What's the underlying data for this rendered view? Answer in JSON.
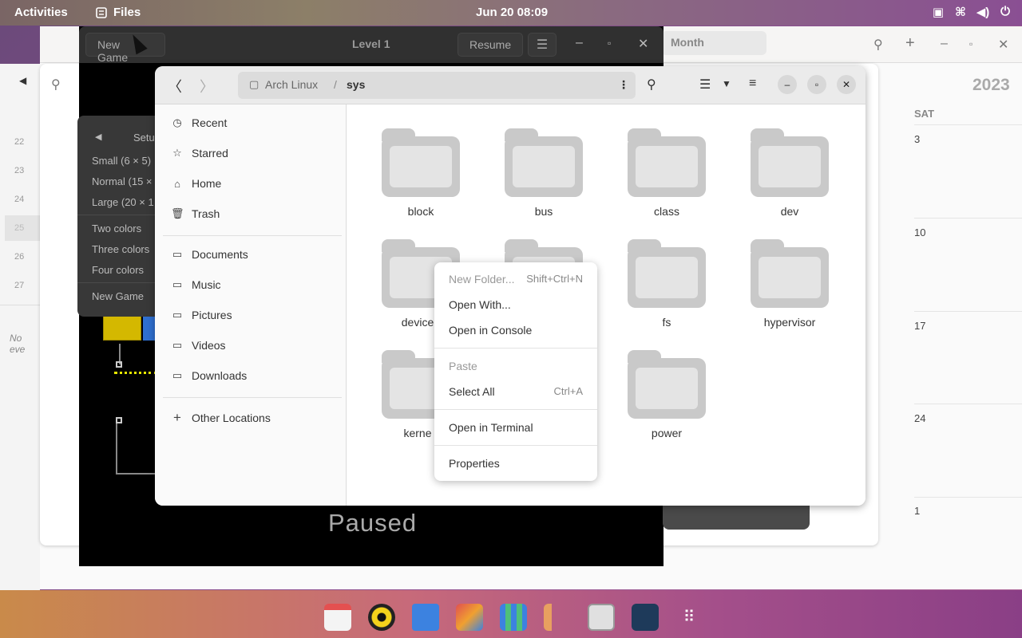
{
  "topbar": {
    "activities": "Activities",
    "app_name": "Files",
    "clock": "Jun 20  08:09"
  },
  "calendar": {
    "month_label": "Month",
    "year": "2023",
    "weekday": "SAT",
    "days": [
      "3",
      "10",
      "17",
      "24",
      "1"
    ],
    "weeks": [
      "22",
      "23",
      "24",
      "25",
      "26",
      "27"
    ],
    "no_events": "No eve"
  },
  "game": {
    "new_game": "New Game",
    "title": "Level 1",
    "resume": "Resume",
    "paused": "Paused",
    "setup_header": "Setu",
    "menu": {
      "small": "Small (6 × 5)",
      "normal": "Normal (15 ×",
      "large": "Large (20 × 1",
      "two": "Two colors",
      "three": "Three colors",
      "four": "Four colors",
      "new_game": "New Game"
    }
  },
  "files": {
    "path": [
      "Arch Linux",
      "/",
      "sys"
    ],
    "sidebar": {
      "recent": "Recent",
      "starred": "Starred",
      "home": "Home",
      "trash": "Trash",
      "documents": "Documents",
      "music": "Music",
      "pictures": "Pictures",
      "videos": "Videos",
      "downloads": "Downloads",
      "other": "Other Locations"
    },
    "folders": [
      "block",
      "bus",
      "class",
      "dev",
      "device",
      "fs",
      "hypervisor",
      "kerne",
      "power"
    ]
  },
  "context_menu": {
    "new_folder": "New Folder...",
    "new_folder_acc": "Shift+Ctrl+N",
    "open_with": "Open With...",
    "open_console": "Open in Console",
    "paste": "Paste",
    "select_all": "Select All",
    "select_all_acc": "Ctrl+A",
    "open_terminal": "Open in Terminal",
    "properties": "Properties"
  },
  "colors": {
    "dock_start": "#c98a4a",
    "dock_end": "#8a3f86",
    "tile_yellow": "#d4b800",
    "tile_blue": "#2f6fd0"
  }
}
